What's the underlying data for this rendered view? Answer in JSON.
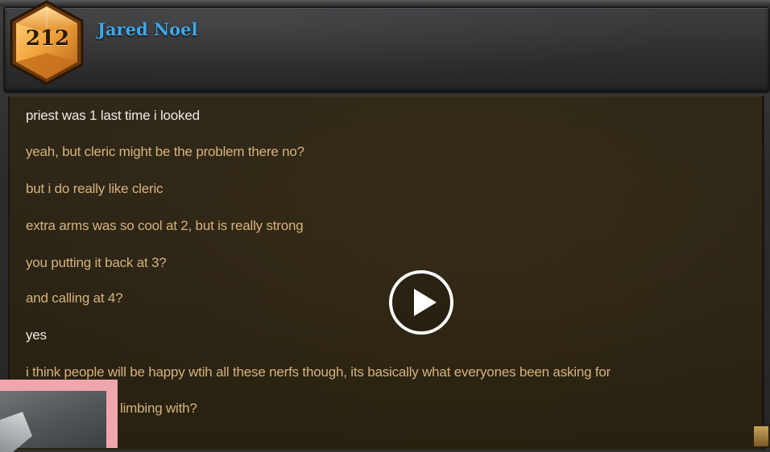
{
  "header": {
    "rank": "212",
    "player_name": "Jared Noel"
  },
  "chat": {
    "messages": [
      {
        "text": "priest was 1 last time i looked",
        "from": "self"
      },
      {
        "text": "yeah, but cleric might be the problem there no?",
        "from": "other"
      },
      {
        "text": "but i do really like cleric",
        "from": "other"
      },
      {
        "text": "extra arms was so cool at 2, but is really strong",
        "from": "other"
      },
      {
        "text": "you putting it back at 3?",
        "from": "other"
      },
      {
        "text": "and  calling at 4?",
        "from": "other"
      },
      {
        "text": "yes",
        "from": "self"
      },
      {
        "text": "i think people will be happy wtih all these nerfs though, its basically what everyones been asking for",
        "from": "other"
      },
      {
        "text": "limbing with?",
        "from": "other"
      }
    ]
  },
  "overlay": {
    "play_icon": "play-icon",
    "webcam": "webcam-feed"
  },
  "colors": {
    "name": "#3fa7e8",
    "self_text": "#f0ece4",
    "other_text": "#d7b27b",
    "panel": "#2b2416",
    "rank_gem": "#e79b2a"
  }
}
